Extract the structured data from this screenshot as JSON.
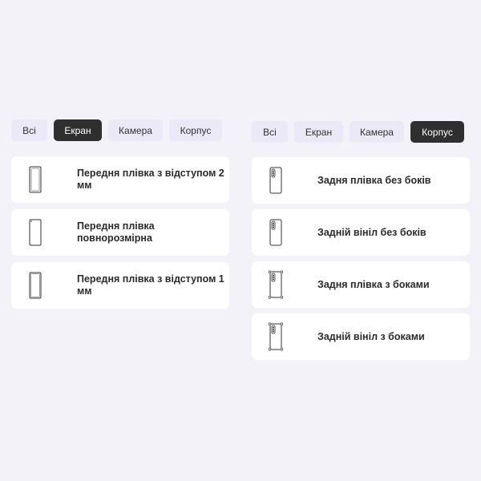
{
  "left": {
    "tabs": [
      {
        "label": "Всі",
        "active": false
      },
      {
        "label": "Екран",
        "active": true
      },
      {
        "label": "Камера",
        "active": false
      },
      {
        "label": "Корпус",
        "active": false
      }
    ],
    "items": [
      {
        "label": "Передня плівка з відступом 2 мм",
        "icon": "phone-front-screen-film-icon"
      },
      {
        "label": "Передня плівка повнорозмірна",
        "icon": "phone-front-fullsize-film-icon"
      },
      {
        "label": "Передня плівка з відступом 1 мм",
        "icon": "phone-front-screen-film-icon"
      }
    ]
  },
  "right": {
    "tabs": [
      {
        "label": "Всі",
        "active": false
      },
      {
        "label": "Екран",
        "active": false
      },
      {
        "label": "Камера",
        "active": false
      },
      {
        "label": "Корпус",
        "active": true
      }
    ],
    "items": [
      {
        "label": "Задня плівка без боків",
        "icon": "phone-back-film-icon"
      },
      {
        "label": "Задній вініл без боків",
        "icon": "phone-back-vinyl-icon"
      },
      {
        "label": "Задня плівка з боками",
        "icon": "phone-back-film-sides-icon"
      },
      {
        "label": "Задній вініл з боками",
        "icon": "phone-back-vinyl-sides-icon"
      }
    ]
  },
  "colors": {
    "background": "#f3f2f8",
    "tab_inactive": "#ebe8f8",
    "tab_active": "#2f2f2f",
    "card": "#ffffff"
  }
}
